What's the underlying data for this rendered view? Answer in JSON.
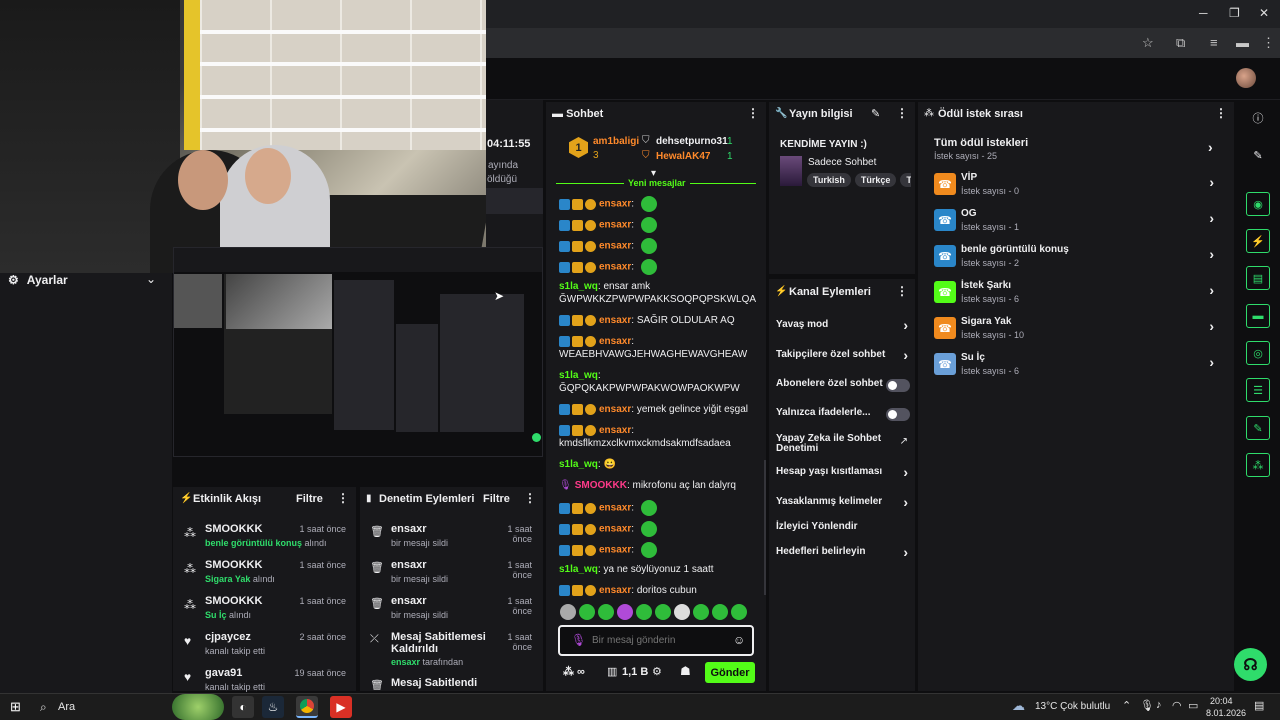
{
  "app": {
    "accent": "#53fc18",
    "bg": "#0e0e10",
    "panel": "#18181b"
  },
  "window_controls": {
    "minimize": "─",
    "maximize": "❐",
    "close": "✕"
  },
  "cam_overlay": {
    "clock": "04:11:55",
    "line1": "ayında",
    "line2": "öldüğü"
  },
  "settings": {
    "title": "Ayarlar"
  },
  "activity": {
    "title": "Etkinlik Akışı",
    "filter": "Filtre",
    "items": [
      {
        "user": "SMOOKKK",
        "reward": "benle görüntülü konuş",
        "suffix": "alındı",
        "time": "1 saat önce",
        "icon": "reward-icon"
      },
      {
        "user": "SMOOKKK",
        "reward": "Sigara Yak",
        "suffix": "alındı",
        "time": "1 saat önce",
        "icon": "reward-icon"
      },
      {
        "user": "SMOOKKK",
        "reward": "Su İç",
        "suffix": "alındı",
        "time": "1 saat önce",
        "icon": "reward-icon"
      },
      {
        "user": "cjpaycez",
        "reward": "",
        "suffix": "kanalı takip etti",
        "time": "2 saat önce",
        "icon": "heart-icon"
      },
      {
        "user": "gava91",
        "reward": "",
        "suffix": "kanalı takip etti",
        "time": "19 saat önce",
        "icon": "heart-icon"
      }
    ]
  },
  "moderation": {
    "title": "Denetim Eylemleri",
    "filter": "Filtre",
    "items": [
      {
        "user": "ensaxr",
        "detail": "bir mesajı sildi",
        "time": "1 saat önce"
      },
      {
        "user": "ensaxr",
        "detail": "bir mesajı sildi",
        "time": "1 saat önce"
      },
      {
        "user": "ensaxr",
        "detail": "bir mesajı sildi",
        "time": "1 saat önce"
      },
      {
        "user": "Mesaj Sabitlemesi Kaldırıldı",
        "detail_user": "ensaxr",
        "detail": "tarafından",
        "time": "1 saat önce"
      },
      {
        "user": "Mesaj Sabitlendi",
        "detail": "",
        "time": ""
      }
    ]
  },
  "chat": {
    "title": "Sohbet",
    "leaderboard": [
      {
        "rank": "1",
        "name": "am1baligi",
        "count": "3"
      },
      {
        "name": "dehsetpurno31",
        "count": "1"
      },
      {
        "name": "HewalAK47",
        "count": "1"
      }
    ],
    "new_messages": "Yeni mesajlar",
    "messages": [
      {
        "user": "ensaxr",
        "text": "",
        "emote": true
      },
      {
        "user": "ensaxr",
        "text": "",
        "emote": true
      },
      {
        "user": "ensaxr",
        "text": "",
        "emote": true
      },
      {
        "user": "ensaxr",
        "text": "",
        "emote": true
      },
      {
        "user": "s1la_wq",
        "text": "ensar amk",
        "text2": "ĞWPWKKZPWPWPAKKSOQPQPSKWLQA"
      },
      {
        "user": "ensaxr",
        "text": "SAĞIR OLDULAR AQ"
      },
      {
        "user": "ensaxr",
        "text": "",
        "text2": "WEAEBHVAWGJEHWAGHEWAVGHEAW"
      },
      {
        "user": "s1la_wq",
        "text": "",
        "text2": "ĞQPQKAKPWPWPAKWOWPAOKWPW"
      },
      {
        "user": "ensaxr",
        "text": "yemek gelince yiğit eşgal"
      },
      {
        "user": "ensaxr",
        "text": "",
        "text2": "kmdsflkmzxclkvmxckmdsakmdfsadaea"
      },
      {
        "user": "s1la_wq",
        "text": "😀"
      },
      {
        "user": "SMOOKKK",
        "text": "mikrofonu aç lan dalyrq"
      },
      {
        "user": "ensaxr",
        "text": "",
        "emote": true
      },
      {
        "user": "ensaxr",
        "text": "",
        "emote": true
      },
      {
        "user": "ensaxr",
        "text": "",
        "emote": true
      },
      {
        "user": "s1la_wq",
        "text": "ya ne söylüyonuz 1 saatt"
      },
      {
        "user": "ensaxr",
        "text": "doritos cubun"
      }
    ],
    "input_placeholder": "Bir mesaj gönderin",
    "viewers": "1,1 B",
    "send": "Gönder"
  },
  "stream_info": {
    "title": "Yayın bilgisi",
    "stream_title": "KENDİME YAYIN :)",
    "category": "Sadece Sohbet",
    "tags": [
      "Turkish",
      "Türkçe",
      "T"
    ]
  },
  "channel_actions": {
    "title": "Kanal Eylemleri",
    "items": [
      {
        "label": "Yavaş mod",
        "control": "chevron"
      },
      {
        "label": "Takipçilere özel sohbet",
        "control": "chevron"
      },
      {
        "label": "Abonelere özel sohbet",
        "control": "toggle"
      },
      {
        "label": "Yalnızca ifadelerle...",
        "control": "toggle"
      },
      {
        "label": "Yapay Zeka ile Sohbet Denetimi",
        "control": "external"
      },
      {
        "label": "Hesap yaşı kısıtlaması",
        "control": "chevron"
      },
      {
        "label": "Yasaklanmış kelimeler",
        "control": "chevron"
      },
      {
        "label": "İzleyici Yönlendir",
        "control": "none"
      },
      {
        "label": "Hedefleri belirleyin",
        "control": "chevron"
      }
    ]
  },
  "rewards": {
    "title": "Ödül istek sırası",
    "all": {
      "label": "Tüm ödül istekleri",
      "count": "İstek sayısı - 25"
    },
    "items": [
      {
        "label": "VİP",
        "count": "İstek sayısı - 0",
        "color": "#f08a1e"
      },
      {
        "label": "OG",
        "count": "İstek sayısı - 1",
        "color": "#2a86c9"
      },
      {
        "label": "benle görüntülü konuş",
        "count": "İstek sayısı - 2",
        "color": "#2a86c9"
      },
      {
        "label": "İstek Şarkı",
        "count": "İstek sayısı - 6",
        "color": "#53fc18"
      },
      {
        "label": "Sigara Yak",
        "count": "İstek sayısı - 10",
        "color": "#f08a1e"
      },
      {
        "label": "Su İç",
        "count": "İstek sayısı - 6",
        "color": "#6a9fd8"
      }
    ]
  },
  "taskbar": {
    "search": "Ara",
    "weather": "13°C  Çok bulutlu",
    "time": "20:04",
    "date": "8.01.2026"
  }
}
